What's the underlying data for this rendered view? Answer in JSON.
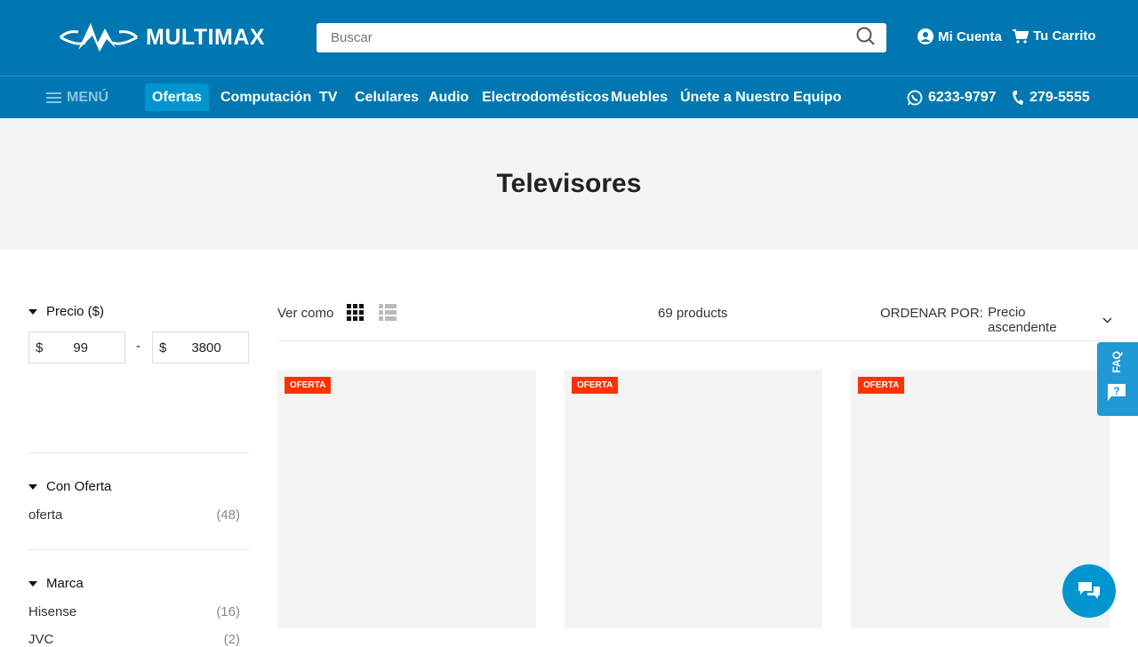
{
  "header": {
    "brand": "MULTIMAX",
    "search_placeholder": "Buscar",
    "account": "Mi Cuenta",
    "cart": "Tu Carrito"
  },
  "nav": {
    "menu": "MENÚ",
    "items": [
      "Ofertas",
      "Computación",
      "TV",
      "Celulares",
      "Audio",
      "Electrodomésticos",
      "Muebles",
      "Únete a Nuestro Equipo"
    ],
    "whatsapp": "6233-9797",
    "phone": "279-5555"
  },
  "page": {
    "title": "Televisores"
  },
  "filters": {
    "price": {
      "label": "Precio ($)",
      "currency": "$",
      "min": "99",
      "max": "3800",
      "sep": "-"
    },
    "offer": {
      "label": "Con Oferta",
      "items": [
        {
          "name": "oferta",
          "count": "(48)"
        }
      ]
    },
    "brand": {
      "label": "Marca",
      "items": [
        {
          "name": "Hisense",
          "count": "(16)"
        },
        {
          "name": "JVC",
          "count": "(2)"
        }
      ]
    }
  },
  "toolbar": {
    "view_as": "Ver como",
    "count": "69 products",
    "sort_label": "ORDENAR POR:",
    "sort_value": "Precio ascendente"
  },
  "products": [
    {
      "badge": "OFERTA"
    },
    {
      "badge": "OFERTA"
    },
    {
      "badge": "OFERTA"
    }
  ],
  "faq": "FAQ"
}
